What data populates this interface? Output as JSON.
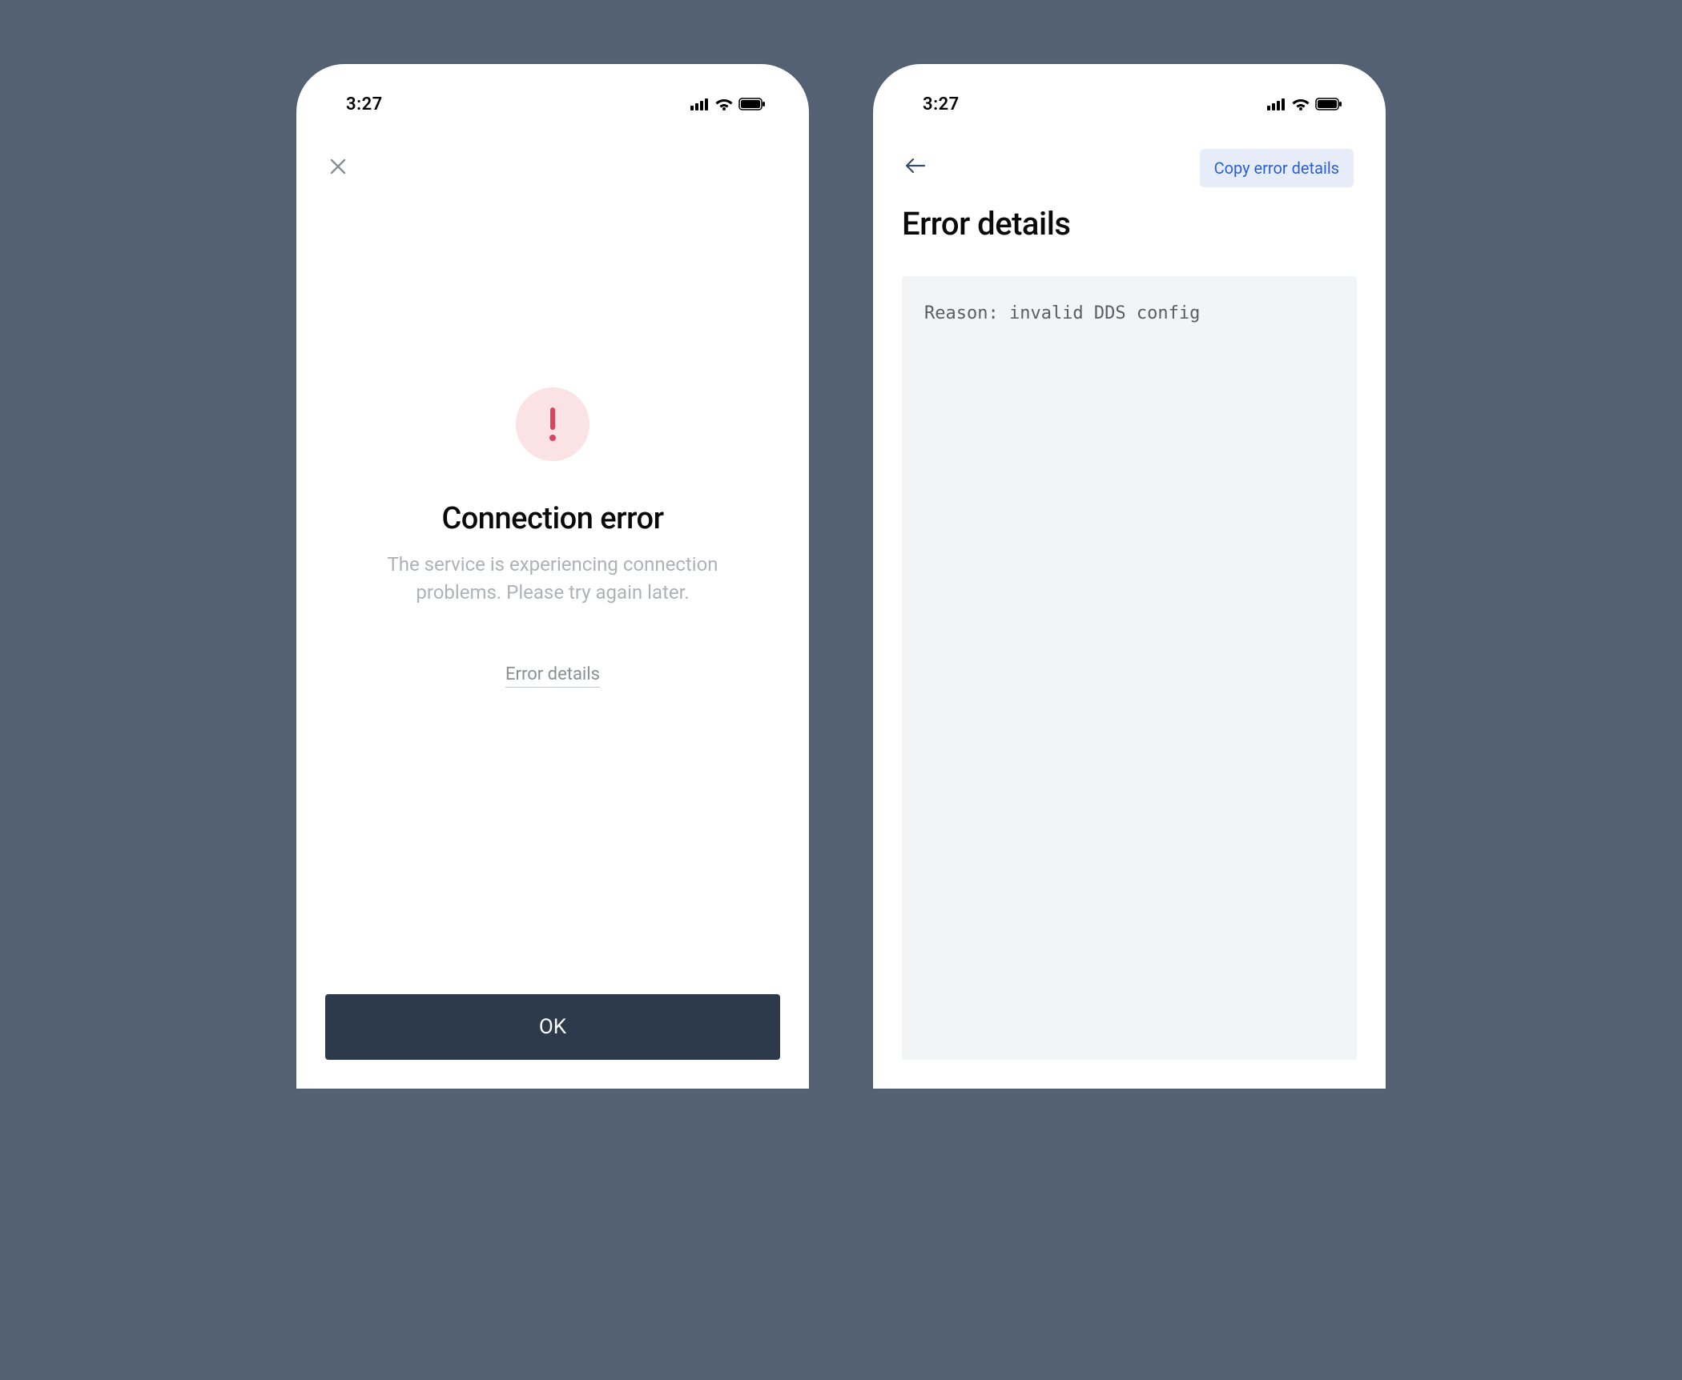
{
  "status_bar": {
    "time": "3:27"
  },
  "left": {
    "title": "Connection error",
    "message": "The service is experiencing connection problems. Please try again later.",
    "details_link": "Error details",
    "ok_button": "OK"
  },
  "right": {
    "copy_button": "Copy error details",
    "title": "Error details",
    "code": "Reason: invalid DDS config"
  }
}
